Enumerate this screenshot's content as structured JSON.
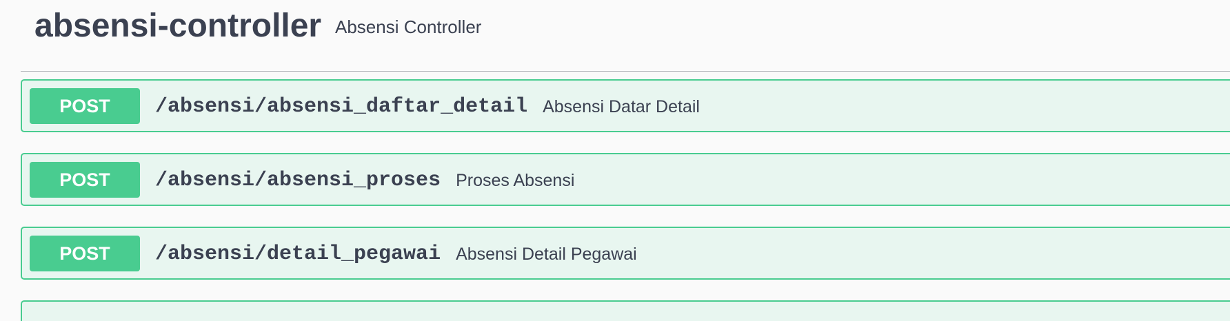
{
  "tag": {
    "name": "absensi-controller",
    "description": "Absensi Controller"
  },
  "operations": [
    {
      "method": "POST",
      "path": "/absensi/absensi_daftar_detail",
      "summary": "Absensi Datar Detail"
    },
    {
      "method": "POST",
      "path": "/absensi/absensi_proses",
      "summary": "Proses Absensi"
    },
    {
      "method": "POST",
      "path": "/absensi/detail_pegawai",
      "summary": "Absensi Detail Pegawai"
    }
  ],
  "colors": {
    "post_accent": "#49cc90",
    "post_background": "#e8f6f0",
    "text": "#3b4151"
  }
}
